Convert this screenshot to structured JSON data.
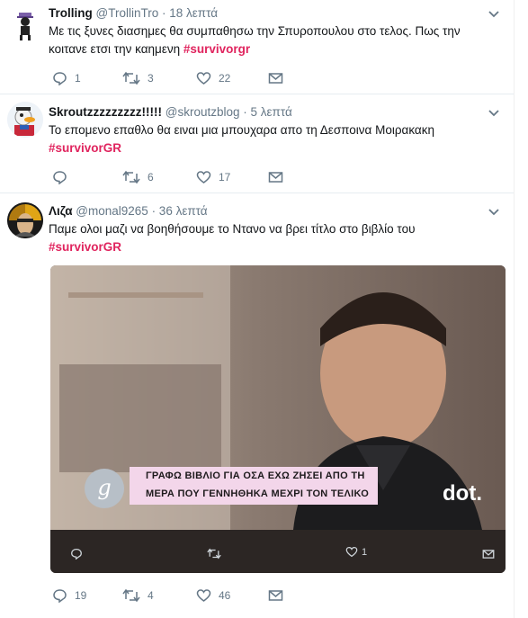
{
  "tweets": [
    {
      "name": "Trolling",
      "handle": "@TrollinTro",
      "time": "· 18 λεπτά",
      "text": "Με τις ξυνες διασημες θα συμπαθησω την Σπυροπουλου στο τελος. Πως την κοιτανε ετσι την καημενη ",
      "hashtag": "#survivorgr",
      "replies": "1",
      "retweets": "3",
      "likes": "22"
    },
    {
      "name": "Skroutzzzzzzzzz!!!!!",
      "handle": "@skroutzblog",
      "time": "· 5 λεπτά",
      "text": "Το επομενο επαθλο θα ειναι μια μπουχαρα απο τη Δεσποινα Μοιρακακη",
      "hashtag": "#survivorGR",
      "replies": "",
      "retweets": "6",
      "likes": "17"
    },
    {
      "name": "Λιζα",
      "handle": "@monal9265",
      "time": "· 36 λεπτά",
      "text": "Παμε ολοι μαζι να βοηθήσουμε το Ντανο να βρει τίτλο στο βιβλίο του",
      "hashtag": "#survivorGR",
      "replies": "19",
      "retweets": "4",
      "likes": "46"
    }
  ],
  "media": {
    "caption_line1": "ΓΡΑΦΩ ΒΙΒΛΙΟ ΓΙΑ ΟΣΑ ΕΧΩ ΖΗΣΕΙ ΑΠΟ ΤΗ",
    "caption_line2": "ΜΕΡΑ ΠΟΥ ΓΕΝΝΗΘΗΚΑ ΜΕΧΡΙ ΤΟΝ ΤΕΛΙΚΟ",
    "logo_g": "g",
    "logo_dot": "dot.",
    "likes": "1"
  },
  "colors": {
    "hashtag": "#e0245e",
    "muted": "#657786",
    "border": "#e6ecf0"
  },
  "icons": [
    "reply-icon",
    "retweet-icon",
    "like-icon",
    "message-icon",
    "chevron-down-icon"
  ]
}
